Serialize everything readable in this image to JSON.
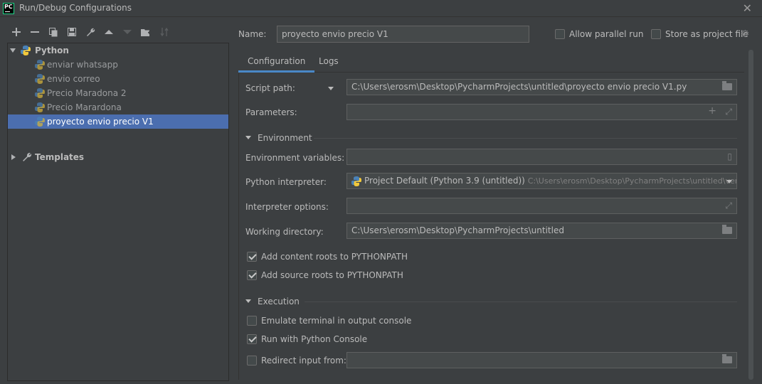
{
  "window": {
    "title": "Run/Debug Configurations",
    "app_icon_text": "PC"
  },
  "toolbar": {
    "buttons": [
      "add-icon",
      "remove-icon",
      "copy-icon",
      "save-icon",
      "wrench-icon",
      "move-up-icon",
      "move-down-icon",
      "new-folder-icon",
      "sort-icon"
    ]
  },
  "tree": {
    "python_label": "Python",
    "items": [
      "enviar whatsapp",
      "envio correo",
      "Precio Maradona 2",
      "Precio Marardona",
      "proyecto envio precio V1"
    ],
    "selected_index": 4,
    "templates_label": "Templates"
  },
  "header": {
    "name_label": "Name:",
    "name_value": "proyecto envio precio V1",
    "allow_parallel_label": "Allow parallel run",
    "allow_parallel_checked": false,
    "store_project_label": "Store as project file",
    "store_project_checked": false
  },
  "tabs": [
    {
      "label": "Configuration",
      "active": true
    },
    {
      "label": "Logs",
      "active": false
    }
  ],
  "config": {
    "script_path_label": "Script path:",
    "script_path_value": "C:\\Users\\erosm\\Desktop\\PycharmProjects\\untitled\\proyecto envio precio V1.py",
    "parameters_label": "Parameters:",
    "parameters_value": "",
    "environment_section": "Environment",
    "env_vars_label": "Environment variables:",
    "env_vars_value": "",
    "interpreter_label": "Python interpreter:",
    "interpreter_value": "Project Default (Python 3.9 (untitled))",
    "interpreter_path": "C:\\Users\\erosm\\Desktop\\PycharmProjects\\untitled\\venv\\Scr",
    "interpreter_options_label": "Interpreter options:",
    "interpreter_options_value": "",
    "working_dir_label": "Working directory:",
    "working_dir_value": "C:\\Users\\erosm\\Desktop\\PycharmProjects\\untitled",
    "add_content_roots_label": "Add content roots to PYTHONPATH",
    "add_content_roots_checked": true,
    "add_source_roots_label": "Add source roots to PYTHONPATH",
    "add_source_roots_checked": true,
    "execution_section": "Execution",
    "emulate_terminal_label": "Emulate terminal in output console",
    "emulate_terminal_checked": false,
    "run_console_label": "Run with Python Console",
    "run_console_checked": true,
    "redirect_input_label": "Redirect input from:",
    "redirect_input_checked": false,
    "redirect_input_value": ""
  },
  "colors": {
    "background": "#3c3f41",
    "selection": "#4b6eaf",
    "accent": "#4a88c7",
    "field": "#45494a"
  }
}
